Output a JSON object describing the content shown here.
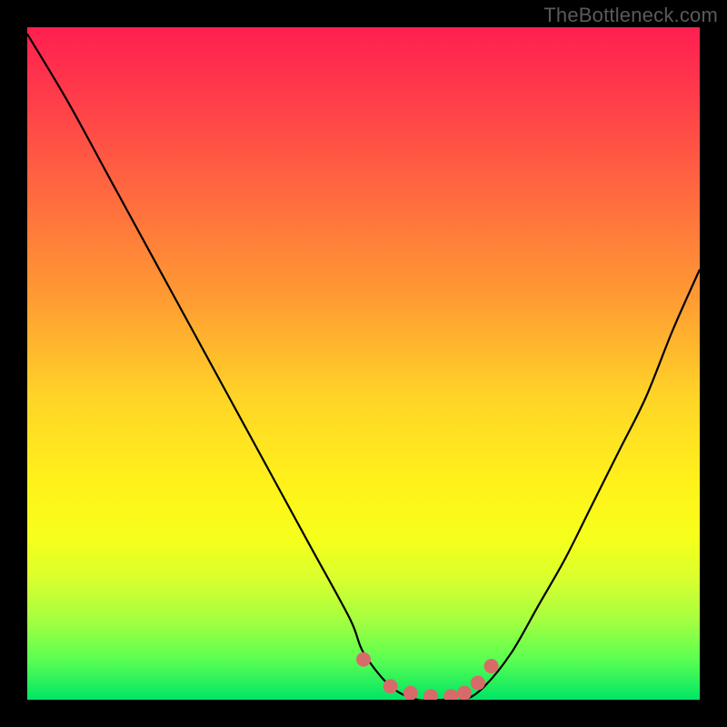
{
  "watermark": "TheBottleneck.com",
  "chart_data": {
    "type": "line",
    "title": "",
    "xlabel": "",
    "ylabel": "",
    "xlim": [
      0,
      100
    ],
    "ylim": [
      0,
      100
    ],
    "series": [
      {
        "name": "curve",
        "x": [
          0,
          6,
          12,
          18,
          24,
          30,
          36,
          42,
          48,
          50,
          54,
          58,
          62,
          65,
          68,
          72,
          76,
          80,
          84,
          88,
          92,
          96,
          100
        ],
        "y": [
          99,
          89,
          78,
          67,
          56,
          45,
          34,
          23,
          12,
          7,
          2,
          0,
          0,
          0,
          2,
          7,
          14,
          21,
          29,
          37,
          45,
          55,
          64
        ]
      }
    ],
    "markers": {
      "name": "highlight-dots",
      "color": "#d96a6a",
      "x": [
        50,
        54,
        57,
        60,
        63,
        65,
        67,
        69
      ],
      "y": [
        6,
        2,
        1,
        0.5,
        0.5,
        1,
        2.5,
        5
      ]
    },
    "colors": {
      "curve": "#000000",
      "marker": "#d96a6a",
      "frame": "#000000"
    }
  }
}
